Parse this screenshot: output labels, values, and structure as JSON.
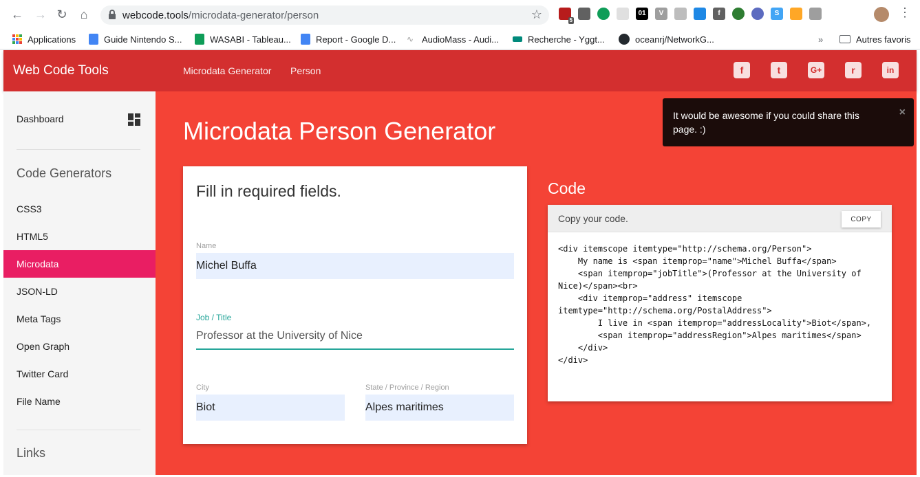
{
  "browser": {
    "url_host": "webcode.tools",
    "url_path": "/microdata-generator/person",
    "bookmarks": [
      {
        "label": "Applications",
        "color": "#4285f4"
      },
      {
        "label": "Guide Nintendo S...",
        "color": "#4285f4"
      },
      {
        "label": "WASABI - Tableau...",
        "color": "#0f9d58"
      },
      {
        "label": "Report - Google D...",
        "color": "#4285f4"
      },
      {
        "label": "AudioMass - Audi...",
        "color": "#9e9e9e"
      },
      {
        "label": "Recherche - Yggt...",
        "color": "#00897b"
      },
      {
        "label": "oceanrj/NetworkG...",
        "color": "#24292e"
      }
    ],
    "bookmarks_overflow": "»",
    "other_bookmarks": "Autres favoris",
    "extension_badge": "5",
    "extension_icons": [
      "ublock-icon",
      "tool-icon",
      "green-drop-icon",
      "grid-icon",
      "01-icon",
      "v-icon",
      "chat-icon",
      "feather-icon",
      "facebook-ext-icon",
      "globe-icon",
      "check-icon",
      "s-icon",
      "fish-icon",
      "tree-icon"
    ]
  },
  "header": {
    "brand": "Web Code Tools",
    "crumbs": [
      "Microdata Generator",
      "Person"
    ],
    "social": [
      {
        "name": "facebook",
        "glyph": "f"
      },
      {
        "name": "twitter",
        "glyph": "t"
      },
      {
        "name": "google-plus",
        "glyph": "G+"
      },
      {
        "name": "reddit",
        "glyph": "r"
      },
      {
        "name": "linkedin",
        "glyph": "in"
      }
    ]
  },
  "sidebar": {
    "dashboard": "Dashboard",
    "section_generators": "Code Generators",
    "items": [
      "CSS3",
      "HTML5",
      "Microdata",
      "JSON-LD",
      "Meta Tags",
      "Open Graph",
      "Twitter Card",
      "File Name"
    ],
    "active_item": "Microdata",
    "section_links": "Links"
  },
  "main": {
    "title": "Microdata Person Generator",
    "form": {
      "heading": "Fill in required fields.",
      "name_label": "Name",
      "name_value": "Michel Buffa",
      "job_label": "Job / Title",
      "job_value": "Professor at the University of Nice",
      "city_label": "City",
      "city_value": "Biot",
      "region_label": "State / Province / Region",
      "region_value": "Alpes maritimes"
    },
    "code": {
      "title": "Code",
      "bar_label": "Copy your code.",
      "copy_button": "COPY",
      "snippet": "<div itemscope itemtype=\"http://schema.org/Person\">\n    My name is <span itemprop=\"name\">Michel Buffa</span>\n    <span itemprop=\"jobTitle\">(Professor at the University of Nice)</span><br>\n    <div itemprop=\"address\" itemscope itemtype=\"http://schema.org/PostalAddress\">\n        I live in <span itemprop=\"addressLocality\">Biot</span>,\n        <span itemprop=\"addressRegion\">Alpes maritimes</span>\n    </div>\n</div>"
    }
  },
  "toast": {
    "message": "It would be awesome if you could share this page. :)",
    "close": "×"
  },
  "colors": {
    "header": "#d32f2f",
    "main_bg": "#f44336",
    "active_item": "#e91e63",
    "focus": "#26a69a"
  }
}
